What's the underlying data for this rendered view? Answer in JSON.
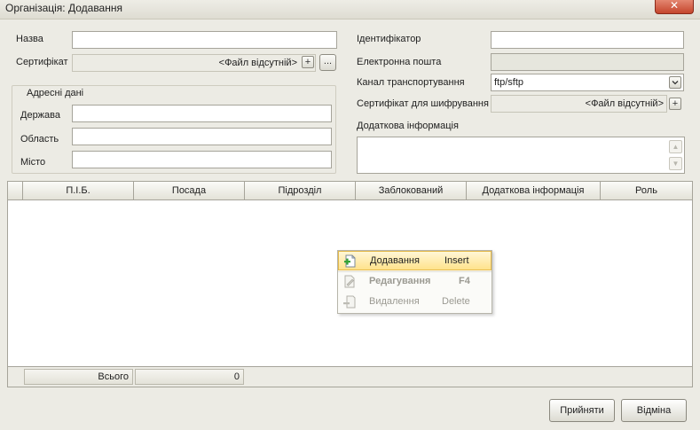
{
  "window": {
    "title": "Організація: Додавання",
    "close_label": "✕"
  },
  "form": {
    "name_label": "Назва",
    "name_value": "",
    "cert_label": "Сертифікат",
    "cert_value": "<Файл відсутній>",
    "add_symbol": "+",
    "browse_symbol": "...",
    "id_label": "Ідентифікатор",
    "id_value": "",
    "email_label": "Електронна пошта",
    "email_value": "",
    "transport_label": "Канал транспортування",
    "transport_value": "ftp/sftp",
    "enc_cert_label": "Сертифікат для шифрування",
    "enc_cert_value": "<Файл відсутній>",
    "extra_label": "Додаткова інформація",
    "extra_value": "",
    "address": {
      "title": "Адресні дані",
      "country_label": "Держава",
      "region_label": "Область",
      "city_label": "Місто"
    }
  },
  "grid": {
    "columns": [
      "П.І.Б.",
      "Посада",
      "Підрозділ",
      "Заблокований",
      "Додаткова інформація",
      "Роль"
    ],
    "rows": [],
    "footer": {
      "total_label": "Всього",
      "total_value": "0"
    }
  },
  "context_menu": {
    "items": [
      {
        "label": "Додавання",
        "shortcut": "Insert",
        "enabled": true,
        "highlighted": true,
        "icon": "add-document-icon"
      },
      {
        "label": "Редагування",
        "shortcut": "F4",
        "enabled": false,
        "highlighted": false,
        "icon": "edit-document-icon"
      },
      {
        "label": "Видалення",
        "shortcut": "Delete",
        "enabled": false,
        "highlighted": false,
        "icon": "delete-document-icon"
      }
    ]
  },
  "buttons": {
    "accept": "Прийняти",
    "cancel": "Відміна"
  },
  "colors": {
    "menu_highlight": "#ffe38c",
    "disabled_text": "#9b9a92"
  }
}
